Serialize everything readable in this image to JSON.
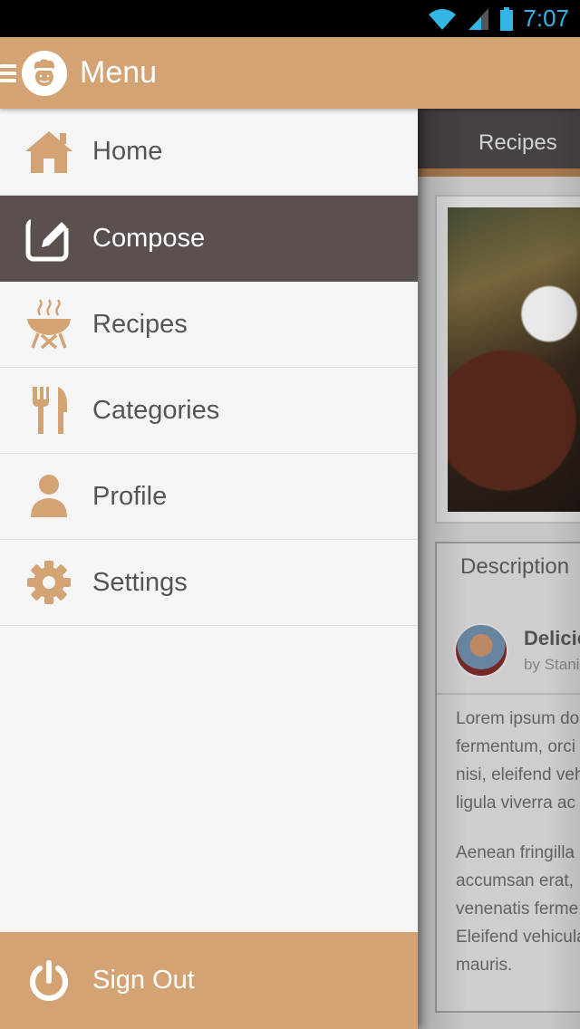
{
  "status_bar": {
    "time": "7:07",
    "icons": [
      "wifi-icon",
      "signal-icon",
      "battery-icon"
    ]
  },
  "action_bar": {
    "title": "Menu",
    "logo": "chef-logo"
  },
  "drawer": {
    "items": [
      {
        "label": "Home",
        "icon": "home-icon",
        "active": false
      },
      {
        "label": "Compose",
        "icon": "compose-icon",
        "active": true
      },
      {
        "label": "Recipes",
        "icon": "grill-icon",
        "active": false
      },
      {
        "label": "Categories",
        "icon": "utensils-icon",
        "active": false
      },
      {
        "label": "Profile",
        "icon": "person-icon",
        "active": false
      },
      {
        "label": "Settings",
        "icon": "gear-icon",
        "active": false
      }
    ],
    "sign_out": {
      "label": "Sign Out",
      "icon": "power-icon"
    }
  },
  "background": {
    "tab_label": "Recipes",
    "description_tab": "Description",
    "recipe_title": "Delicio",
    "author_byline": "by Stani",
    "paragraph1": [
      "Lorem ipsum do",
      "fermentum, orci",
      "nisi, eleifend veh",
      "ligula viverra ac"
    ],
    "paragraph2": [
      "Aenean fringilla",
      "accumsan erat,",
      "venenatis ferme",
      "Eleifend vehicula",
      "mauris."
    ]
  },
  "colors": {
    "accent": "#d4a373",
    "active_item": "#5a514e",
    "drawer_bg": "#f5f5f5",
    "status_text": "#33b5e5"
  }
}
